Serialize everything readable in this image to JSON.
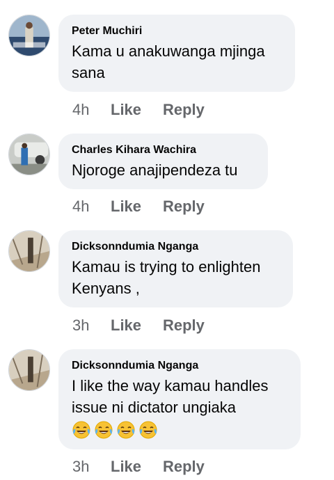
{
  "comments": [
    {
      "author": "Peter Muchiri",
      "text_lines": [
        "Kama u anakuwanga mjinga",
        "sana"
      ],
      "time": "4h",
      "like_label": "Like",
      "reply_label": "Reply"
    },
    {
      "author": "Charles Kihara Wachira",
      "text_lines": [
        "Njoroge anajipendeza tu"
      ],
      "time": "4h",
      "like_label": "Like",
      "reply_label": "Reply"
    },
    {
      "author": "Dicksonndumia Nganga",
      "text_lines": [
        "Kamau is trying to enlighten",
        "Kenyans ,"
      ],
      "time": "3h",
      "like_label": "Like",
      "reply_label": "Reply"
    },
    {
      "author": "Dicksonndumia Nganga",
      "text_lines": [
        "I like the way kamau handles",
        "issue ni dictator ungiaka"
      ],
      "emojis": [
        "tears-of-joy-emoji",
        "tears-of-joy-emoji",
        "tears-of-joy-emoji",
        "tears-of-joy-emoji"
      ],
      "time": "3h",
      "like_label": "Like",
      "reply_label": "Reply"
    }
  ],
  "colors": {
    "bubble": "#f0f2f5",
    "meta_text": "#65676b",
    "primary_text": "#050505",
    "emoji_face": "#f7c234"
  }
}
